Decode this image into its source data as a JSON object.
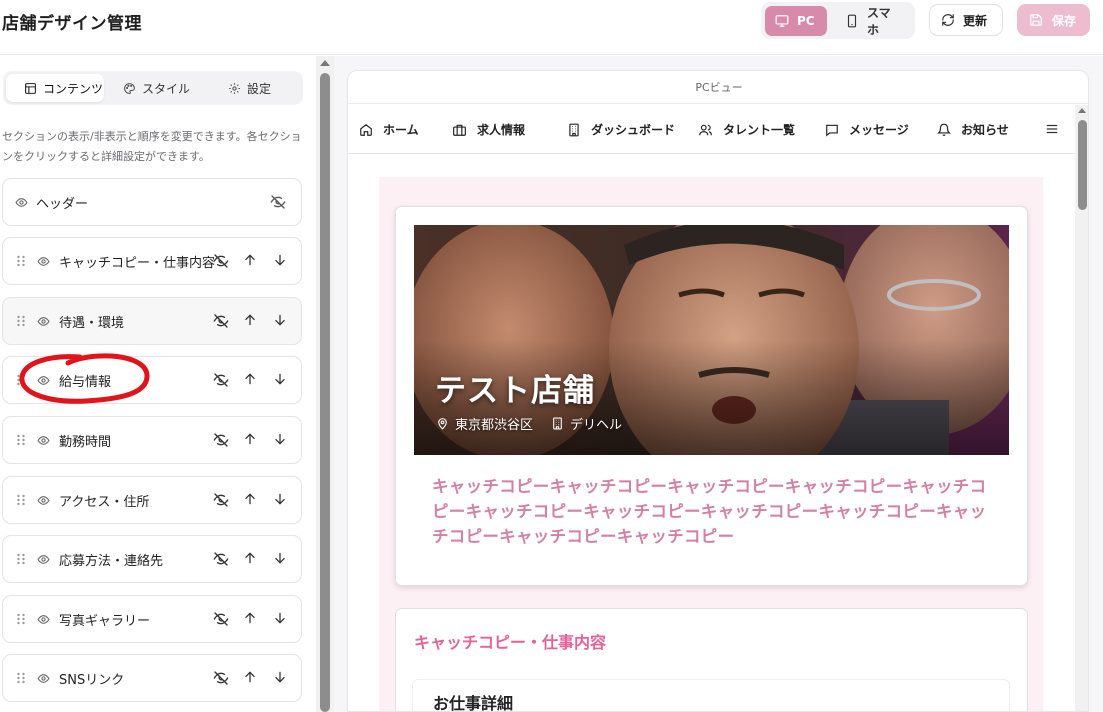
{
  "app": {
    "title": "店舗デザイン管理"
  },
  "toolbar": {
    "pc_label": "PC",
    "mobile_label": "スマホ",
    "refresh_label": "更新",
    "save_label": "保存"
  },
  "tabs": [
    {
      "label": "コンテンツ",
      "active": true
    },
    {
      "label": "スタイル",
      "active": false
    },
    {
      "label": "設定",
      "active": false
    }
  ],
  "description": "セクションの表示/非表示と順序を変更できます。各セクションをクリックすると詳細設定ができます。",
  "sections": [
    {
      "label": "ヘッダー"
    },
    {
      "label": "キャッチコピー・仕事内容"
    },
    {
      "label": "待遇・環境"
    },
    {
      "label": "給与情報"
    },
    {
      "label": "勤務時間"
    },
    {
      "label": "アクセス・住所"
    },
    {
      "label": "応募方法・連絡先"
    },
    {
      "label": "写真ギャラリー"
    },
    {
      "label": "SNSリンク"
    }
  ],
  "preview": {
    "header": "PCビュー",
    "nav": [
      {
        "label": "ホーム",
        "icon": "home-icon"
      },
      {
        "label": "求人情報",
        "icon": "briefcase-icon"
      },
      {
        "label": "ダッシュボード",
        "icon": "building-icon"
      },
      {
        "label": "タレント一覧",
        "icon": "users-icon"
      },
      {
        "label": "メッセージ",
        "icon": "message-icon"
      },
      {
        "label": "お知らせ",
        "icon": "bell-icon"
      }
    ],
    "store_name": "テスト店舗",
    "location": "東京都渋谷区",
    "category": "デリヘル",
    "catch_copy": "キャッチコピーキャッチコピーキャッチコピーキャッチコピーキャッチコピーキャッチコピーキャッチコピーキャッチコピーキャッチコピーキャッチコピーキャッチコピーキャッチコピー",
    "section_title": "キャッチコピー・仕事内容",
    "sub_title": "お仕事詳細"
  },
  "colors": {
    "accent": "#d78aaa",
    "save_disabled": "#eebccf",
    "catch_copy": "#d47fa6",
    "section_title": "#e8609a",
    "preview_bg": "#fdf0f5",
    "annotation": "#e0141a"
  }
}
